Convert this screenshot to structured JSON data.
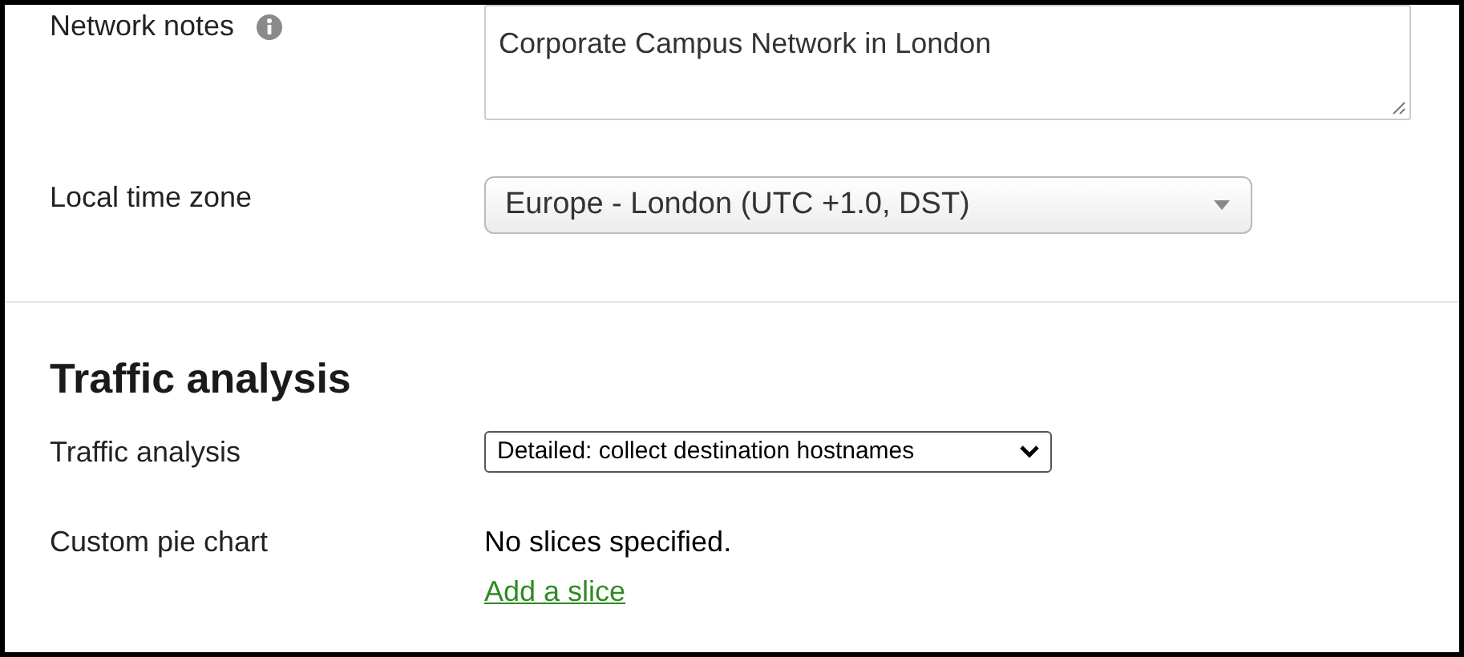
{
  "general": {
    "fields": [
      {
        "kind": "textarea",
        "label": "Network notes",
        "info": true,
        "value": "Corporate Campus Network in London"
      },
      {
        "kind": "select",
        "label": "Local time zone",
        "value": "Europe - London (UTC +1.0, DST)"
      }
    ]
  },
  "traffic_analysis": {
    "heading": "Traffic analysis",
    "fields": [
      {
        "kind": "native_select",
        "label": "Traffic analysis",
        "value": "Detailed: collect destination hostnames"
      },
      {
        "kind": "pie",
        "label": "Custom pie chart",
        "text": "No slices specified.",
        "link": "Add a slice"
      }
    ]
  }
}
